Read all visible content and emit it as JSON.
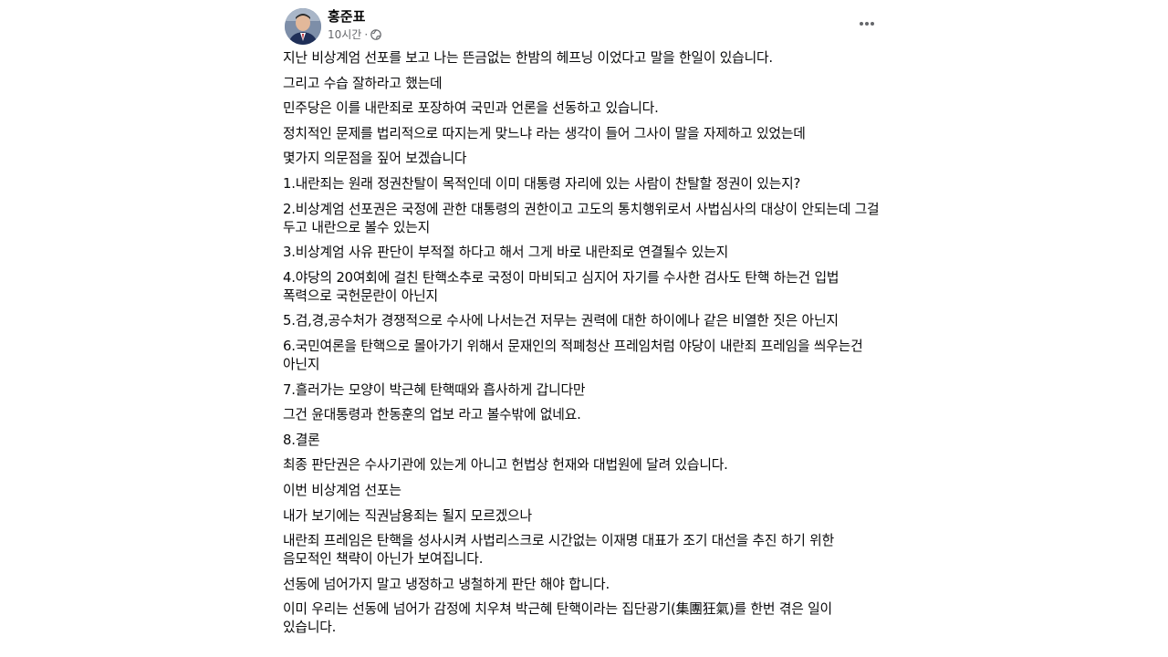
{
  "post": {
    "author": "홍준표",
    "time": "10시간",
    "separator": "·",
    "audience_icon": "globe-icon",
    "more_icon": "more-horizontal-icon",
    "paragraphs": [
      "지난 비상계엄 선포를 보고 나는 뜬금없는 한밤의 헤프닝 이었다고 말을 한일이 있습니다.",
      "그리고 수습 잘하라고 했는데",
      "민주당은 이를 내란죄로 포장하여 국민과 언론을 선동하고 있습니다.",
      "정치적인 문제를 법리적으로 따지는게 맞느냐 라는 생각이 들어 그사이 말을 자제하고 있었는데",
      "몇가지 의문점을 짚어 보겠습니다",
      "1.내란죄는 원래 정권찬탈이 목적인데 이미 대통령 자리에 있는 사람이 찬탈할 정권이 있는지?",
      "2.비상계엄 선포권은 국정에 관한 대통령의 권한이고 고도의 통치행위로서 사법심사의 대상이 안되는데 그걸 두고 내란으로 볼수 있는지",
      "3.비상계엄 사유 판단이 부적절 하다고 해서 그게 바로 내란죄로 연결될수 있는지",
      "4.야당의 20여회에 걸친 탄핵소추로 국정이 마비되고 심지어 자기를 수사한 검사도 탄핵 하는건 입법 폭력으로 국헌문란이 아닌지",
      "5.검,경,공수처가 경쟁적으로 수사에 나서는건 저무는 권력에 대한 하이에나 같은 비열한 짓은 아닌지",
      "6.국민여론을 탄핵으로 몰아가기 위해서 문재인의 적폐청산 프레임처럼 야당이 내란죄 프레임을 씌우는건 아닌지",
      "7.흘러가는 모양이 박근혜 탄핵때와 흡사하게  갑니다만",
      "그건 윤대통령과 한동훈의 업보 라고 볼수밖에 없네요.",
      "8.결론",
      "최종 판단권은 수사기관에 있는게 아니고 헌법상 헌재와 대법원에 달려 있습니다.",
      "이번 비상계엄 선포는",
      "내가 보기에는 직권남용죄는 될지 모르겠으나",
      "내란죄 프레임은 탄핵을 성사시켜  사법리스크로 시간없는 이재명 대표가 조기 대선을 추진 하기 위한 음모적인  책략이 아닌가 보여집니다.",
      "선동에 넘어가지 말고 냉정하고 냉철하게 판단 해야 합니다.",
      "이미 우리는 선동에 넘어가 감정에 치우쳐 박근혜 탄핵이라는 집단광기(集團狂氣)를 한번 겪은 일이 있습니다."
    ]
  }
}
